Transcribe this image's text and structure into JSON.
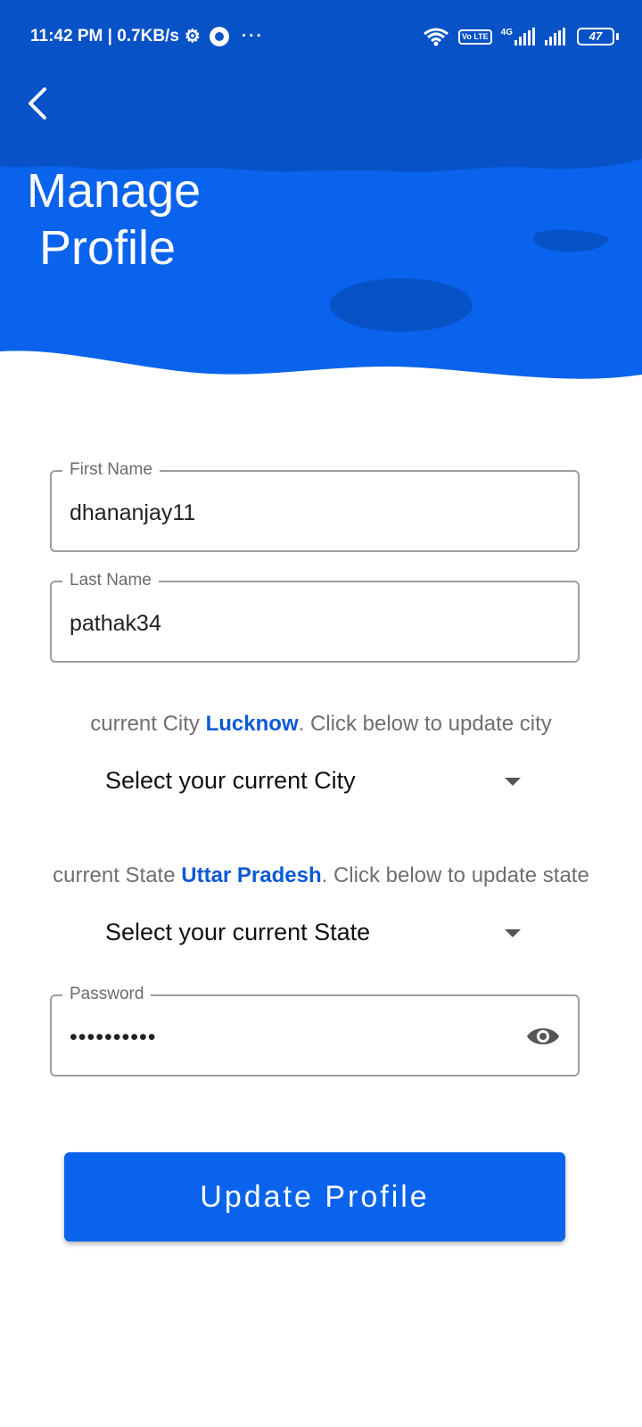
{
  "status_bar": {
    "time_speed": "11:42 PM | 0.7KB/s",
    "more": "···",
    "volte": "Vo LTE",
    "network": "4G",
    "battery": "47"
  },
  "header": {
    "title_line1": "Manage",
    "title_line2": "Profile"
  },
  "form": {
    "first_name": {
      "label": "First Name",
      "value": "dhananjay11"
    },
    "last_name": {
      "label": "Last Name",
      "value": "pathak34"
    },
    "city": {
      "prefix": "current City",
      "current": "Lucknow",
      "suffix": ". Click below to update city",
      "select_placeholder": "Select your current City"
    },
    "state": {
      "prefix": "current State",
      "current": "Uttar Pradesh",
      "suffix": ". Click below to update state",
      "select_placeholder": "Select your current State"
    },
    "password": {
      "label": "Password",
      "value": "••••••••••"
    },
    "submit_label": "Update Profile"
  },
  "colors": {
    "header_blue": "#0a63ec",
    "header_dark_blue": "#0652c6",
    "accent": "#0a5ad6"
  }
}
